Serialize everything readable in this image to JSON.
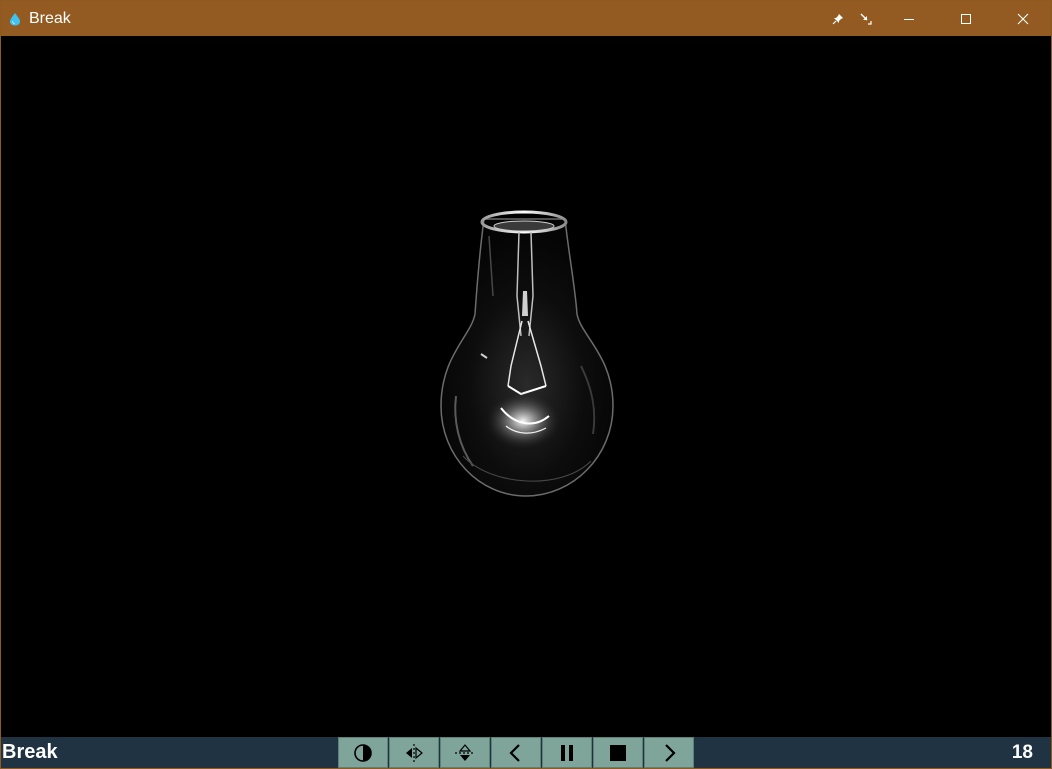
{
  "window": {
    "title": "Break",
    "app_icon": "water-drop-icon",
    "title_bar_color": "#935b21",
    "controls": [
      "pin-icon",
      "resize-icon",
      "minimize-icon",
      "maximize-icon",
      "close-icon"
    ]
  },
  "content": {
    "image_subject": "light-bulb-image"
  },
  "statusbar": {
    "name": "Break",
    "count": "18",
    "background": "#1f3342",
    "button_color": "#7fa59b",
    "buttons": [
      "contrast-icon",
      "flip-horizontal-icon",
      "flip-vertical-icon",
      "previous-icon",
      "pause-icon",
      "stop-icon",
      "next-icon"
    ]
  }
}
